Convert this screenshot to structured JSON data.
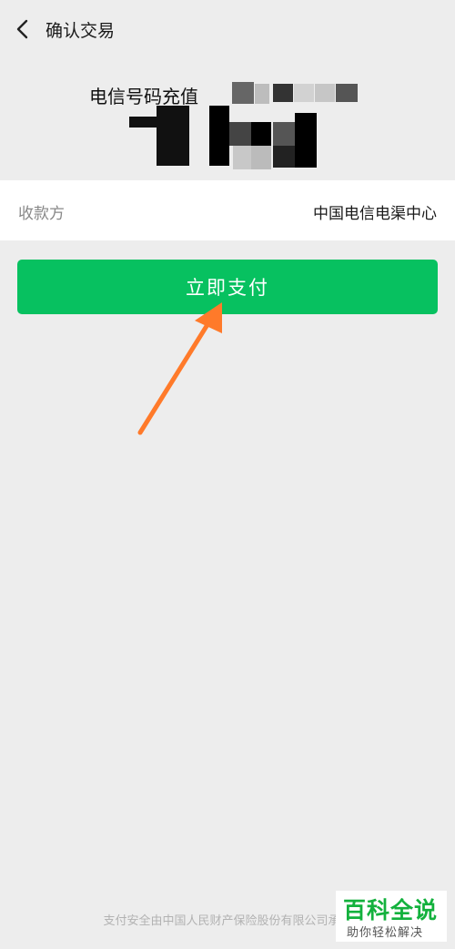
{
  "header": {
    "title": "确认交易",
    "back_icon": "chevron-left-icon"
  },
  "order": {
    "product_prefix": "电信号码充值"
  },
  "payee": {
    "label": "收款方",
    "value": "中国电信电渠中心"
  },
  "actions": {
    "pay_label": "立即支付"
  },
  "footer": {
    "insurance_text": "支付安全由中国人民财产保险股份有限公司承保"
  },
  "watermark": {
    "title": "百科全说",
    "subtitle": "助你轻松解决"
  },
  "colors": {
    "primary": "#07c160",
    "background": "#ededed",
    "arrow": "#ff7a2a"
  }
}
